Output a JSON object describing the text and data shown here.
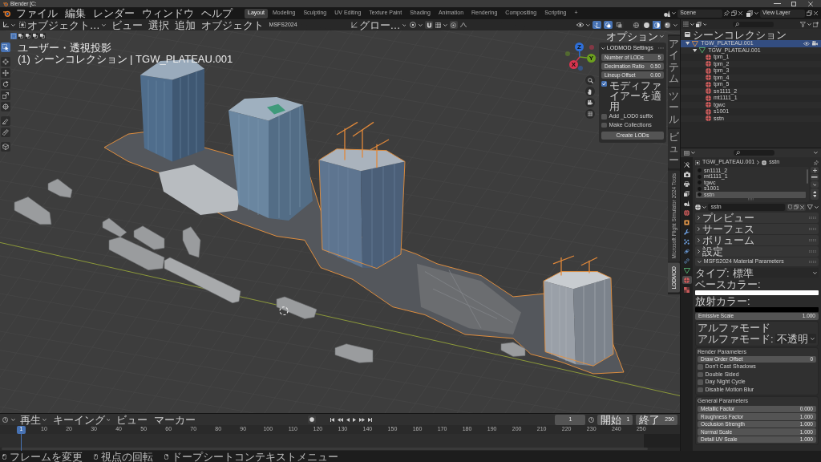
{
  "window": {
    "title": "Blender [C:"
  },
  "menu": [
    "ファイル",
    "編集",
    "レンダー",
    "ウィンドウ",
    "ヘルプ"
  ],
  "workspaces": [
    {
      "label": "Layout",
      "selected": true
    },
    {
      "label": "Modeling",
      "selected": false
    },
    {
      "label": "Sculpting",
      "selected": false
    },
    {
      "label": "UV Editing",
      "selected": false
    },
    {
      "label": "Texture Paint",
      "selected": false
    },
    {
      "label": "Shading",
      "selected": false
    },
    {
      "label": "Animation",
      "selected": false
    },
    {
      "label": "Rendering",
      "selected": false
    },
    {
      "label": "Compositing",
      "selected": false
    },
    {
      "label": "Scripting",
      "selected": false
    }
  ],
  "add_workspace": "+",
  "scene": "Scene",
  "view_layer": "View Layer",
  "viewport": {
    "mode": "オブジェクト…",
    "menus": [
      "ビュー",
      "選択",
      "追加",
      "オブジェクト",
      "MSFS2024"
    ],
    "orientation": "グロー…",
    "toggles": [
      {
        "kind": "gizmo",
        "on": true
      },
      {
        "kind": "overlay",
        "on": true
      },
      {
        "kind": "xray",
        "on": false
      }
    ],
    "shading": [
      {
        "kind": "wireframe",
        "selected": false
      },
      {
        "kind": "solid",
        "selected": false
      },
      {
        "kind": "material",
        "selected": true
      },
      {
        "kind": "rendered",
        "selected": false
      }
    ],
    "select_modes": [
      {
        "kind": "new",
        "selected": true
      },
      {
        "kind": "extend",
        "selected": false
      },
      {
        "kind": "subtract",
        "selected": false
      },
      {
        "kind": "difference",
        "selected": false
      },
      {
        "kind": "intersect",
        "selected": false
      }
    ],
    "options": "オプション",
    "view_name": "ユーザー・透視投影",
    "collection_info": "(1) シーンコレクション | TGW_PLATEAU.001",
    "tools": [
      {
        "kind": "select",
        "selected": true
      },
      {
        "kind": "cursor",
        "selected": false
      },
      {
        "kind": "move",
        "selected": false
      },
      {
        "kind": "rotate",
        "selected": false
      },
      {
        "kind": "scale",
        "selected": false
      },
      {
        "kind": "transform",
        "selected": false
      },
      {
        "kind": "annotate",
        "selected": false
      },
      {
        "kind": "measure",
        "selected": false
      },
      {
        "kind": "add-cube",
        "selected": false
      }
    ],
    "gizmo": [
      {
        "label": "Z",
        "color": "#2e6fd8"
      },
      {
        "label": "Y",
        "color": "#6c9f1e"
      },
      {
        "label": "X",
        "color": "#d9344f"
      }
    ],
    "sidebar_tabs": [
      {
        "kind": "stacked",
        "label": "アイテム",
        "selected": false
      },
      {
        "kind": "stacked",
        "label": "ツール",
        "selected": false
      },
      {
        "kind": "stacked",
        "label": "ビュー",
        "selected": false
      },
      {
        "kind": "rotated",
        "label": "Microsoft Flight Simulator 2024 Tools",
        "selected": false
      },
      {
        "kind": "rotated",
        "label": "LODMOD",
        "selected": true
      }
    ]
  },
  "lodmod": {
    "title": "LODMOD Settings",
    "expanded": true,
    "fields": [
      {
        "label": "Number of LODs",
        "value": "5"
      },
      {
        "label": "Decimation Ratio",
        "value": "0.50"
      },
      {
        "label": "Lineup Offset",
        "value": "0.00"
      }
    ],
    "checkboxes": [
      {
        "label": "モディファイアーを適用",
        "checked": true
      },
      {
        "label": "Add _LOD0 suffix",
        "checked": false
      },
      {
        "label": "Make Collections",
        "checked": false
      }
    ],
    "button": "Create LODs"
  },
  "outliner": {
    "root": {
      "label": "シーンコレクション"
    },
    "items": [
      {
        "kind": "object",
        "label": "TGW_PLATEAU.001",
        "selected": true,
        "expanded": true,
        "visible": true,
        "children": [
          {
            "kind": "mesh",
            "label": "TGW_PLATEAU.001",
            "selected": false,
            "expanded": true,
            "children": [
              {
                "kind": "material",
                "label": "tpm_1",
                "selected": false
              },
              {
                "kind": "material",
                "label": "tpm_2",
                "selected": false
              },
              {
                "kind": "material",
                "label": "tpm_3",
                "selected": false
              },
              {
                "kind": "material",
                "label": "tpm_4",
                "selected": false
              },
              {
                "kind": "material",
                "label": "tpm_5",
                "selected": false
              },
              {
                "kind": "material",
                "label": "sn1111_2",
                "selected": false
              },
              {
                "kind": "material",
                "label": "mt1111_1",
                "selected": false
              },
              {
                "kind": "material",
                "label": "tgwc",
                "selected": false
              },
              {
                "kind": "material",
                "label": "s1001",
                "selected": false
              },
              {
                "kind": "material",
                "label": "sstn",
                "selected": false
              }
            ]
          }
        ]
      }
    ]
  },
  "properties": {
    "tabs": [
      {
        "kind": "tool",
        "selected": false
      },
      {
        "kind": "render",
        "selected": false
      },
      {
        "kind": "output",
        "selected": false
      },
      {
        "kind": "view-layer",
        "selected": false
      },
      {
        "kind": "scene",
        "selected": false
      },
      {
        "kind": "world",
        "selected": false
      },
      {
        "kind": "object",
        "selected": false
      },
      {
        "kind": "modifier",
        "selected": false
      },
      {
        "kind": "particles",
        "selected": false
      },
      {
        "kind": "physics",
        "selected": false
      },
      {
        "kind": "constraints",
        "selected": false
      },
      {
        "kind": "data",
        "selected": false
      },
      {
        "kind": "material",
        "selected": true
      },
      {
        "kind": "texture",
        "selected": false
      }
    ],
    "breadcrumb": [
      "TGW_PLATEAU.001",
      "sstn"
    ],
    "slots": [
      {
        "label": "sn1111_2",
        "selected": false
      },
      {
        "label": "mt1111_1",
        "selected": false
      },
      {
        "label": "tgwc",
        "selected": false
      },
      {
        "label": "s1001",
        "selected": false
      },
      {
        "label": "sstn",
        "selected": true
      }
    ],
    "material": "sstn",
    "panels": [
      {
        "label": "プレビュー",
        "expanded": false
      },
      {
        "label": "サーフェス",
        "expanded": false
      },
      {
        "label": "ボリューム",
        "expanded": false
      },
      {
        "label": "設定",
        "expanded": false
      },
      {
        "label": "MSFS2024 Material Parameters",
        "expanded": true,
        "body": {
          "type": {
            "label": "タイプ:",
            "value": "標準"
          },
          "base_color": {
            "label": "ベースカラー:",
            "color": "#ffffff"
          },
          "emissive_color": {
            "label": "放射カラー:",
            "color": "#000000"
          },
          "emissive_scale": {
            "label": "Emissive Scale",
            "value": "1.000"
          },
          "alpha": {
            "title": "アルファモード",
            "label": "アルファモード:",
            "value": "不透明"
          },
          "render": {
            "title": "Render Parameters",
            "fields": [
              {
                "label": "Draw Order Offset",
                "value": "0"
              }
            ],
            "checkboxes": [
              {
                "label": "Don't Cast Shadows",
                "checked": false
              },
              {
                "label": "Double Sided",
                "checked": false
              },
              {
                "label": "Day Night Cycle",
                "checked": false
              },
              {
                "label": "Disable Motion Blur",
                "checked": false
              }
            ]
          },
          "general": {
            "title": "General Parameters",
            "fields": [
              {
                "label": "Metallic Factor",
                "value": "0.000"
              },
              {
                "label": "Roughness Factor",
                "value": "1.000"
              },
              {
                "label": "Occlusion Strength",
                "value": "1.000"
              },
              {
                "label": "Normal Scale",
                "value": "1.000"
              },
              {
                "label": "Detail UV Scale",
                "value": "1.000"
              }
            ]
          }
        }
      }
    ]
  },
  "timeline": {
    "menus": [
      {
        "label": "再生",
        "dropdown": true
      },
      {
        "label": "キーイング",
        "dropdown": true
      },
      {
        "label": "ビュー",
        "dropdown": false
      },
      {
        "label": "マーカー",
        "dropdown": false
      }
    ],
    "frame": "1",
    "start_label": "開始",
    "start": "1",
    "end_label": "終了",
    "end": "250",
    "current_frame": "1",
    "ticks": [
      "10",
      "20",
      "30",
      "40",
      "50",
      "60",
      "70",
      "80",
      "90",
      "100",
      "110",
      "120",
      "130",
      "140",
      "150",
      "160",
      "170",
      "180",
      "190",
      "200",
      "210",
      "220",
      "230",
      "240",
      "250"
    ]
  },
  "status_bar": [
    {
      "kind": "left",
      "label": "フレームを変更"
    },
    {
      "kind": "middle",
      "label": "視点の回転"
    },
    {
      "kind": "right",
      "label": "ドープシートコンテキストメニュー"
    }
  ]
}
